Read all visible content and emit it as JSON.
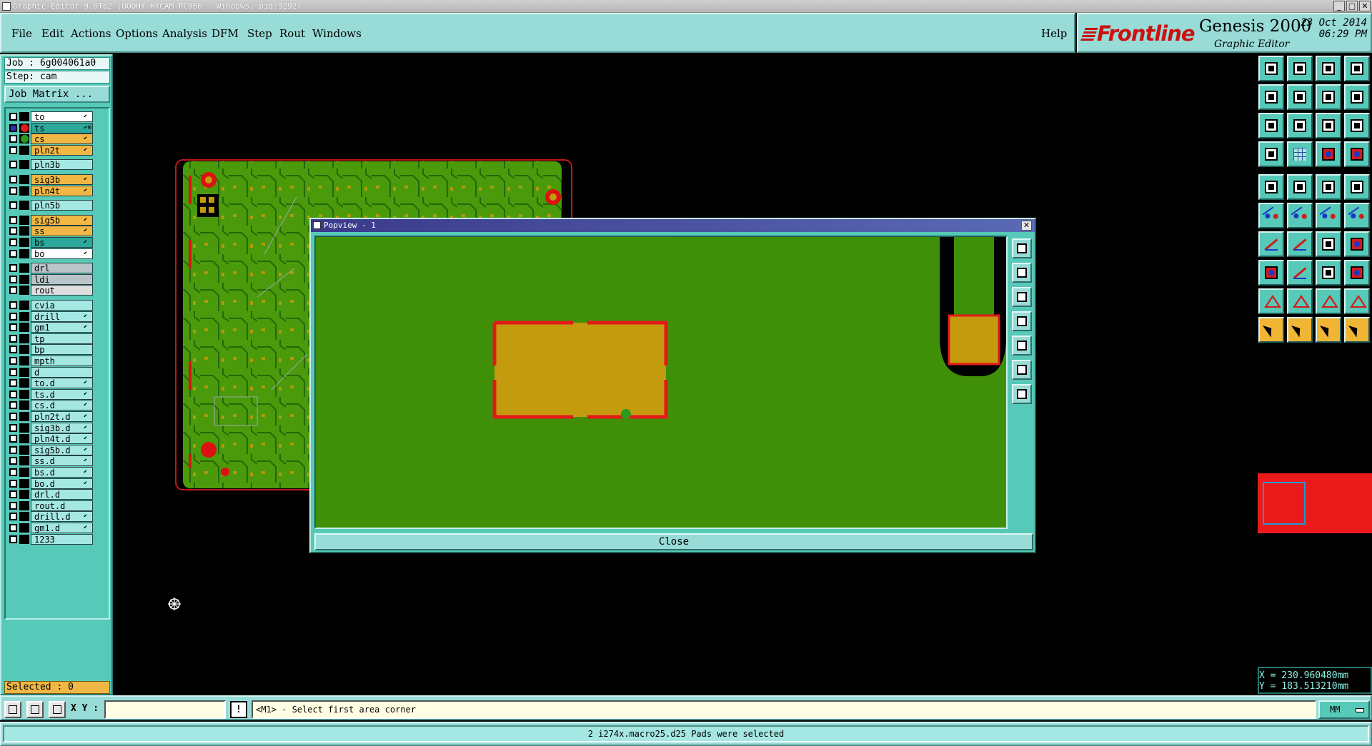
{
  "window": {
    "title": "Graphic Editor 9.0Tb2 (OOOHY-HYCAM-PC066 - Windows, pid:9292)",
    "buttons": [
      "_",
      "□",
      "✕"
    ]
  },
  "menu": [
    "File",
    "Edit",
    "Actions",
    "Options",
    "Analysis",
    "DFM",
    "Step",
    "Rout",
    "Windows"
  ],
  "help_label": "Help",
  "brand": {
    "logo": "Frontline",
    "product": "Genesis 2000",
    "subtitle": "Graphic Editor",
    "date": "23 Oct 2014",
    "time": "06:29 PM"
  },
  "job": {
    "job_line": "Job : 6g004061a0",
    "step_line": "Step: cam",
    "matrix_button": "Job Matrix ..."
  },
  "layers": [
    {
      "name": "to",
      "color": "#ffffff",
      "checked": false,
      "dot": null,
      "side": "⬋"
    },
    {
      "name": "ts",
      "color": "#2ba89a",
      "checked": true,
      "dot": "#e31919",
      "side": "⬋⊗"
    },
    {
      "name": "cs",
      "color": "#f1b744",
      "checked": false,
      "dot": "#2c9a1d",
      "side": "⬋"
    },
    {
      "name": "pln2t",
      "color": "#f1b744",
      "checked": false,
      "dot": null,
      "side": "⬋"
    },
    {
      "name": "pln3b",
      "color": "#a5e7e2",
      "checked": false,
      "dot": null,
      "side": ""
    },
    {
      "name": "sig3b",
      "color": "#f1b744",
      "checked": false,
      "dot": null,
      "side": "⬋"
    },
    {
      "name": "pln4t",
      "color": "#f1b744",
      "checked": false,
      "dot": null,
      "side": "⬋"
    },
    {
      "name": "pln5b",
      "color": "#a5e7e2",
      "checked": false,
      "dot": null,
      "side": ""
    },
    {
      "name": "sig5b",
      "color": "#f1b744",
      "checked": false,
      "dot": null,
      "side": "⬋"
    },
    {
      "name": "ss",
      "color": "#f1b744",
      "checked": false,
      "dot": null,
      "side": "⬋"
    },
    {
      "name": "bs",
      "color": "#2ba89a",
      "checked": false,
      "dot": null,
      "side": "⬋"
    },
    {
      "name": "bo",
      "color": "#ffffff",
      "checked": false,
      "dot": null,
      "side": "⬋"
    },
    {
      "name": "drl",
      "color": "#b9c4c8",
      "checked": false,
      "dot": null,
      "side": ""
    },
    {
      "name": "ldi",
      "color": "#b9c4c8",
      "checked": false,
      "dot": null,
      "side": ""
    },
    {
      "name": "rout",
      "color": "#dedede",
      "checked": false,
      "dot": null,
      "side": ""
    },
    {
      "name": "cvia",
      "color": "#a5e7e2",
      "checked": false,
      "dot": null,
      "side": ""
    },
    {
      "name": "drill",
      "color": "#a5e7e2",
      "checked": false,
      "dot": null,
      "side": "⬋"
    },
    {
      "name": "gm1",
      "color": "#a5e7e2",
      "checked": false,
      "dot": null,
      "side": "⬋"
    },
    {
      "name": "tp",
      "color": "#a5e7e2",
      "checked": false,
      "dot": null,
      "side": ""
    },
    {
      "name": "bp",
      "color": "#a5e7e2",
      "checked": false,
      "dot": null,
      "side": ""
    },
    {
      "name": "mpth",
      "color": "#a5e7e2",
      "checked": false,
      "dot": null,
      "side": ""
    },
    {
      "name": "d",
      "color": "#a5e7e2",
      "checked": false,
      "dot": null,
      "side": ""
    },
    {
      "name": "to.d",
      "color": "#a5e7e2",
      "checked": false,
      "dot": null,
      "side": "⬋"
    },
    {
      "name": "ts.d",
      "color": "#a5e7e2",
      "checked": false,
      "dot": null,
      "side": "⬋"
    },
    {
      "name": "cs.d",
      "color": "#a5e7e2",
      "checked": false,
      "dot": null,
      "side": "⬋"
    },
    {
      "name": "pln2t.d",
      "color": "#a5e7e2",
      "checked": false,
      "dot": null,
      "side": "⬋"
    },
    {
      "name": "sig3b.d",
      "color": "#a5e7e2",
      "checked": false,
      "dot": null,
      "side": "⬋"
    },
    {
      "name": "pln4t.d",
      "color": "#a5e7e2",
      "checked": false,
      "dot": null,
      "side": "⬋"
    },
    {
      "name": "sig5b.d",
      "color": "#a5e7e2",
      "checked": false,
      "dot": null,
      "side": "⬋"
    },
    {
      "name": "ss.d",
      "color": "#a5e7e2",
      "checked": false,
      "dot": null,
      "side": "⬋"
    },
    {
      "name": "bs.d",
      "color": "#a5e7e2",
      "checked": false,
      "dot": null,
      "side": "⬋"
    },
    {
      "name": "bo.d",
      "color": "#a5e7e2",
      "checked": false,
      "dot": null,
      "side": "⬋"
    },
    {
      "name": "drl.d",
      "color": "#a5e7e2",
      "checked": false,
      "dot": null,
      "side": ""
    },
    {
      "name": "rout.d",
      "color": "#a5e7e2",
      "checked": false,
      "dot": null,
      "side": ""
    },
    {
      "name": "drill.d",
      "color": "#a5e7e2",
      "checked": false,
      "dot": null,
      "side": "⬋"
    },
    {
      "name": "gm1.d",
      "color": "#a5e7e2",
      "checked": false,
      "dot": null,
      "side": "⬋"
    },
    {
      "name": "1233",
      "color": "#a5e7e2",
      "checked": false,
      "dot": null,
      "side": ""
    }
  ],
  "selected_label": "Selected : 0",
  "popview": {
    "title": "Popview - 1",
    "close_label": "Close",
    "tools": [
      "zoom-window-icon",
      "zoom-home-icon",
      "zoom-in-icon",
      "pan-left-icon",
      "pan-right-icon",
      "fit-icon",
      "center-icon"
    ]
  },
  "toolbar_icons": [
    "layer-up-icon",
    "layer-down-icon",
    "home-icon",
    "split-view-icon",
    "pan-left-icon",
    "pan-right-icon",
    "undo-view-icon",
    "redraw-icon",
    "zoom-fit-icon",
    "zoom-center-icon",
    "scale-1-2-icon",
    "help-query-icon",
    "snap-icon",
    "grid-icon",
    "measure-icon",
    "measure-alt-icon",
    "add-pad-icon",
    "add-surface-icon",
    "add-line-icon",
    "add-circle-icon",
    "connect-icon",
    "delete-node-icon",
    "move-node-icon",
    "move-vertex-icon",
    "add-arc-icon",
    "add-segment-icon",
    "rotate-icon",
    "split-icon",
    "add-feature-icon",
    "cut-icon",
    "resize-icon",
    "copy-icon",
    "triangle-fill-icon",
    "triangle-a-icon",
    "triangle-b-icon",
    "triangle-c-icon",
    "select-icon",
    "select-add-icon",
    "select-toggle-icon",
    "select-move-icon"
  ],
  "coords": {
    "x_text": "X = 230.960480mm",
    "y_text": "Y = 183.513210mm"
  },
  "command": {
    "xy_label": "X Y :",
    "xy_value": "",
    "prompt_icon": "!",
    "prompt": "<M1> - Select first area corner",
    "units": "MM"
  },
  "status_message": "2 i274x.macro25.d25 Pads were selected"
}
